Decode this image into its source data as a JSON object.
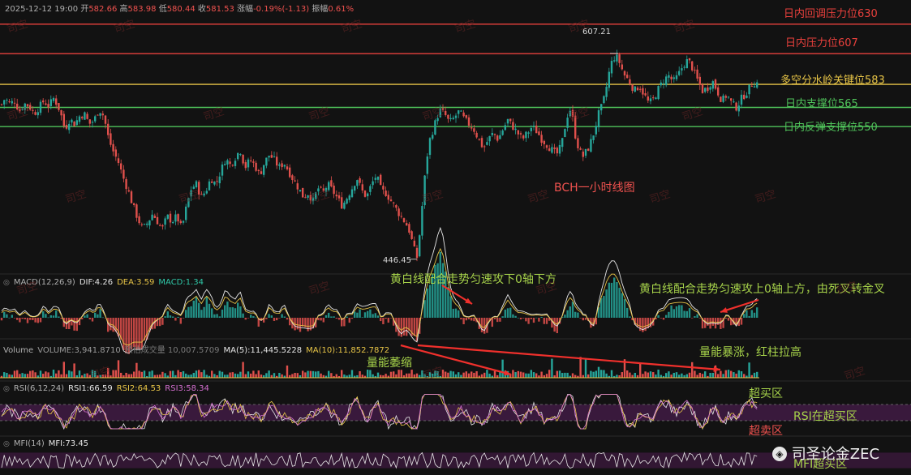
{
  "header": {
    "datetime": "2025-12-12 19:00",
    "open_label": "开",
    "open": "582.66",
    "high_label": "高",
    "high": "583.98",
    "low_label": "低",
    "low": "580.44",
    "close_label": "收",
    "close": "581.53",
    "change_label": "涨幅",
    "change": "-0.19%(-1.13)",
    "amplitude_label": "振幅",
    "amplitude": "0.61%"
  },
  "levels": [
    {
      "text": "日内回调压力位630",
      "price": 630,
      "color": "#e8403c"
    },
    {
      "text": "日内压力位607",
      "price": 607,
      "color": "#e8403c"
    },
    {
      "text": "多空分水岭关键位583",
      "price": 583,
      "color": "#e8c547"
    },
    {
      "text": "日内支撑位565",
      "price": 565,
      "color": "#4fc25a"
    },
    {
      "text": "日内反弹支撑位550",
      "price": 550,
      "color": "#4fc25a"
    }
  ],
  "price_labels": {
    "high_mark": "607.21",
    "low_mark": "446.45"
  },
  "chart_title": "BCH一小时线图",
  "macd": {
    "title": "MACD(12,26,9)",
    "dif": "DIF:4.26",
    "dea": "DEA:3.59",
    "macd": "MACD:1.34",
    "annotation_left": "黄白线配合走势匀速攻下0轴下方",
    "annotation_right": "黄白线配合走势匀速攻上0轴上方，由死叉转金叉"
  },
  "volume": {
    "title": "Volume",
    "vol": "VOLUME:3,941.8710",
    "est": "预估成交量 10,007.5709",
    "ma5": "MA(5):11,445.5228",
    "ma10": "MA(10):11,852.7872",
    "annotation_left": "量能萎缩",
    "annotation_right": "量能暴涨，红柱拉高"
  },
  "rsi": {
    "title": "RSI(6,12,24)",
    "rsi1": "RSI1:66.59",
    "rsi2": "RSI2:64.53",
    "rsi3": "RSI3:58.34",
    "overbought": "超买区",
    "note": "RSI在超买区",
    "oversold": "超卖区"
  },
  "mfi": {
    "title": "MFI(14)",
    "value": "MFI:73.45",
    "note": "MFI超买区"
  },
  "watermark": {
    "text": "司空",
    "brand": "司圣论金ZEC"
  },
  "chart_data": {
    "type": "candlestick",
    "title": "BCH一小时线图",
    "ylim": [
      440,
      640
    ],
    "levels": [
      630,
      607,
      583,
      565,
      550
    ],
    "anchors_close": [
      [
        0,
        565
      ],
      [
        6,
        572
      ],
      [
        12,
        568
      ],
      [
        18,
        570
      ],
      [
        24,
        562
      ],
      [
        30,
        568
      ],
      [
        36,
        566
      ],
      [
        42,
        560
      ],
      [
        48,
        565
      ],
      [
        54,
        570
      ],
      [
        60,
        566
      ],
      [
        66,
        572
      ],
      [
        70,
        568
      ],
      [
        74,
        562
      ],
      [
        80,
        548
      ],
      [
        86,
        556
      ],
      [
        92,
        552
      ],
      [
        98,
        558
      ],
      [
        104,
        560
      ],
      [
        110,
        552
      ],
      [
        116,
        555
      ],
      [
        122,
        564
      ],
      [
        128,
        558
      ],
      [
        134,
        540
      ],
      [
        140,
        530
      ],
      [
        146,
        522
      ],
      [
        152,
        510
      ],
      [
        158,
        500
      ],
      [
        164,
        488
      ],
      [
        170,
        478
      ],
      [
        176,
        470
      ],
      [
        182,
        475
      ],
      [
        188,
        482
      ],
      [
        194,
        476
      ],
      [
        200,
        470
      ],
      [
        206,
        480
      ],
      [
        212,
        476
      ],
      [
        218,
        480
      ],
      [
        224,
        470
      ],
      [
        230,
        488
      ],
      [
        236,
        502
      ],
      [
        242,
        505
      ],
      [
        248,
        495
      ],
      [
        254,
        500
      ],
      [
        260,
        510
      ],
      [
        266,
        505
      ],
      [
        272,
        515
      ],
      [
        278,
        525
      ],
      [
        284,
        520
      ],
      [
        290,
        526
      ],
      [
        296,
        532
      ],
      [
        302,
        518
      ],
      [
        308,
        524
      ],
      [
        314,
        520
      ],
      [
        320,
        512
      ],
      [
        326,
        522
      ],
      [
        332,
        528
      ],
      [
        338,
        524
      ],
      [
        344,
        518
      ],
      [
        350,
        522
      ],
      [
        356,
        515
      ],
      [
        362,
        508
      ],
      [
        368,
        502
      ],
      [
        374,
        495
      ],
      [
        380,
        498
      ],
      [
        386,
        492
      ],
      [
        392,
        502
      ],
      [
        398,
        498
      ],
      [
        404,
        505
      ],
      [
        410,
        500
      ],
      [
        416,
        494
      ],
      [
        422,
        488
      ],
      [
        428,
        495
      ],
      [
        434,
        502
      ],
      [
        440,
        510
      ],
      [
        446,
        500
      ],
      [
        452,
        495
      ],
      [
        458,
        505
      ],
      [
        464,
        512
      ],
      [
        470,
        500
      ],
      [
        476,
        498
      ],
      [
        482,
        492
      ],
      [
        488,
        486
      ],
      [
        494,
        480
      ],
      [
        500,
        475
      ],
      [
        505,
        468
      ],
      [
        510,
        455
      ],
      [
        514,
        448
      ],
      [
        518,
        470
      ],
      [
        522,
        500
      ],
      [
        526,
        525
      ],
      [
        530,
        540
      ],
      [
        534,
        548
      ],
      [
        538,
        556
      ],
      [
        542,
        563
      ],
      [
        548,
        560
      ],
      [
        554,
        553
      ],
      [
        560,
        557
      ],
      [
        566,
        562
      ],
      [
        572,
        556
      ],
      [
        578,
        552
      ],
      [
        584,
        548
      ],
      [
        590,
        540
      ],
      [
        596,
        533
      ],
      [
        602,
        540
      ],
      [
        608,
        545
      ],
      [
        614,
        540
      ],
      [
        620,
        548
      ],
      [
        626,
        555
      ],
      [
        632,
        550
      ],
      [
        638,
        545
      ],
      [
        644,
        540
      ],
      [
        650,
        545
      ],
      [
        656,
        550
      ],
      [
        662,
        546
      ],
      [
        668,
        540
      ],
      [
        674,
        536
      ],
      [
        680,
        532
      ],
      [
        686,
        528
      ],
      [
        692,
        535
      ],
      [
        698,
        555
      ],
      [
        702,
        565
      ],
      [
        706,
        556
      ],
      [
        710,
        540
      ],
      [
        714,
        532
      ],
      [
        718,
        526
      ],
      [
        722,
        530
      ],
      [
        726,
        534
      ],
      [
        732,
        545
      ],
      [
        738,
        560
      ],
      [
        742,
        566
      ],
      [
        746,
        575
      ],
      [
        750,
        590
      ],
      [
        754,
        600
      ],
      [
        758,
        605
      ],
      [
        762,
        603
      ],
      [
        766,
        596
      ],
      [
        770,
        590
      ],
      [
        776,
        585
      ],
      [
        782,
        578
      ],
      [
        788,
        582
      ],
      [
        794,
        575
      ],
      [
        800,
        568
      ],
      [
        806,
        572
      ],
      [
        812,
        580
      ],
      [
        818,
        586
      ],
      [
        824,
        590
      ],
      [
        830,
        585
      ],
      [
        836,
        590
      ],
      [
        842,
        598
      ],
      [
        848,
        602
      ],
      [
        852,
        598
      ],
      [
        856,
        592
      ],
      [
        860,
        586
      ],
      [
        866,
        578
      ],
      [
        872,
        580
      ],
      [
        878,
        586
      ],
      [
        884,
        578
      ],
      [
        890,
        570
      ],
      [
        896,
        575
      ],
      [
        902,
        568
      ],
      [
        908,
        565
      ],
      [
        914,
        572
      ],
      [
        918,
        575
      ],
      [
        922,
        578
      ],
      [
        926,
        583
      ],
      [
        932,
        585
      ],
      [
        936,
        582
      ]
    ],
    "macd_range": [
      -10,
      10
    ],
    "rsi_range": [
      0,
      100
    ],
    "rsi_overbought": 70,
    "rsi_oversold": 30,
    "rsi_last": [
      66.59,
      64.53,
      58.34
    ],
    "mfi_last": 73.45
  }
}
